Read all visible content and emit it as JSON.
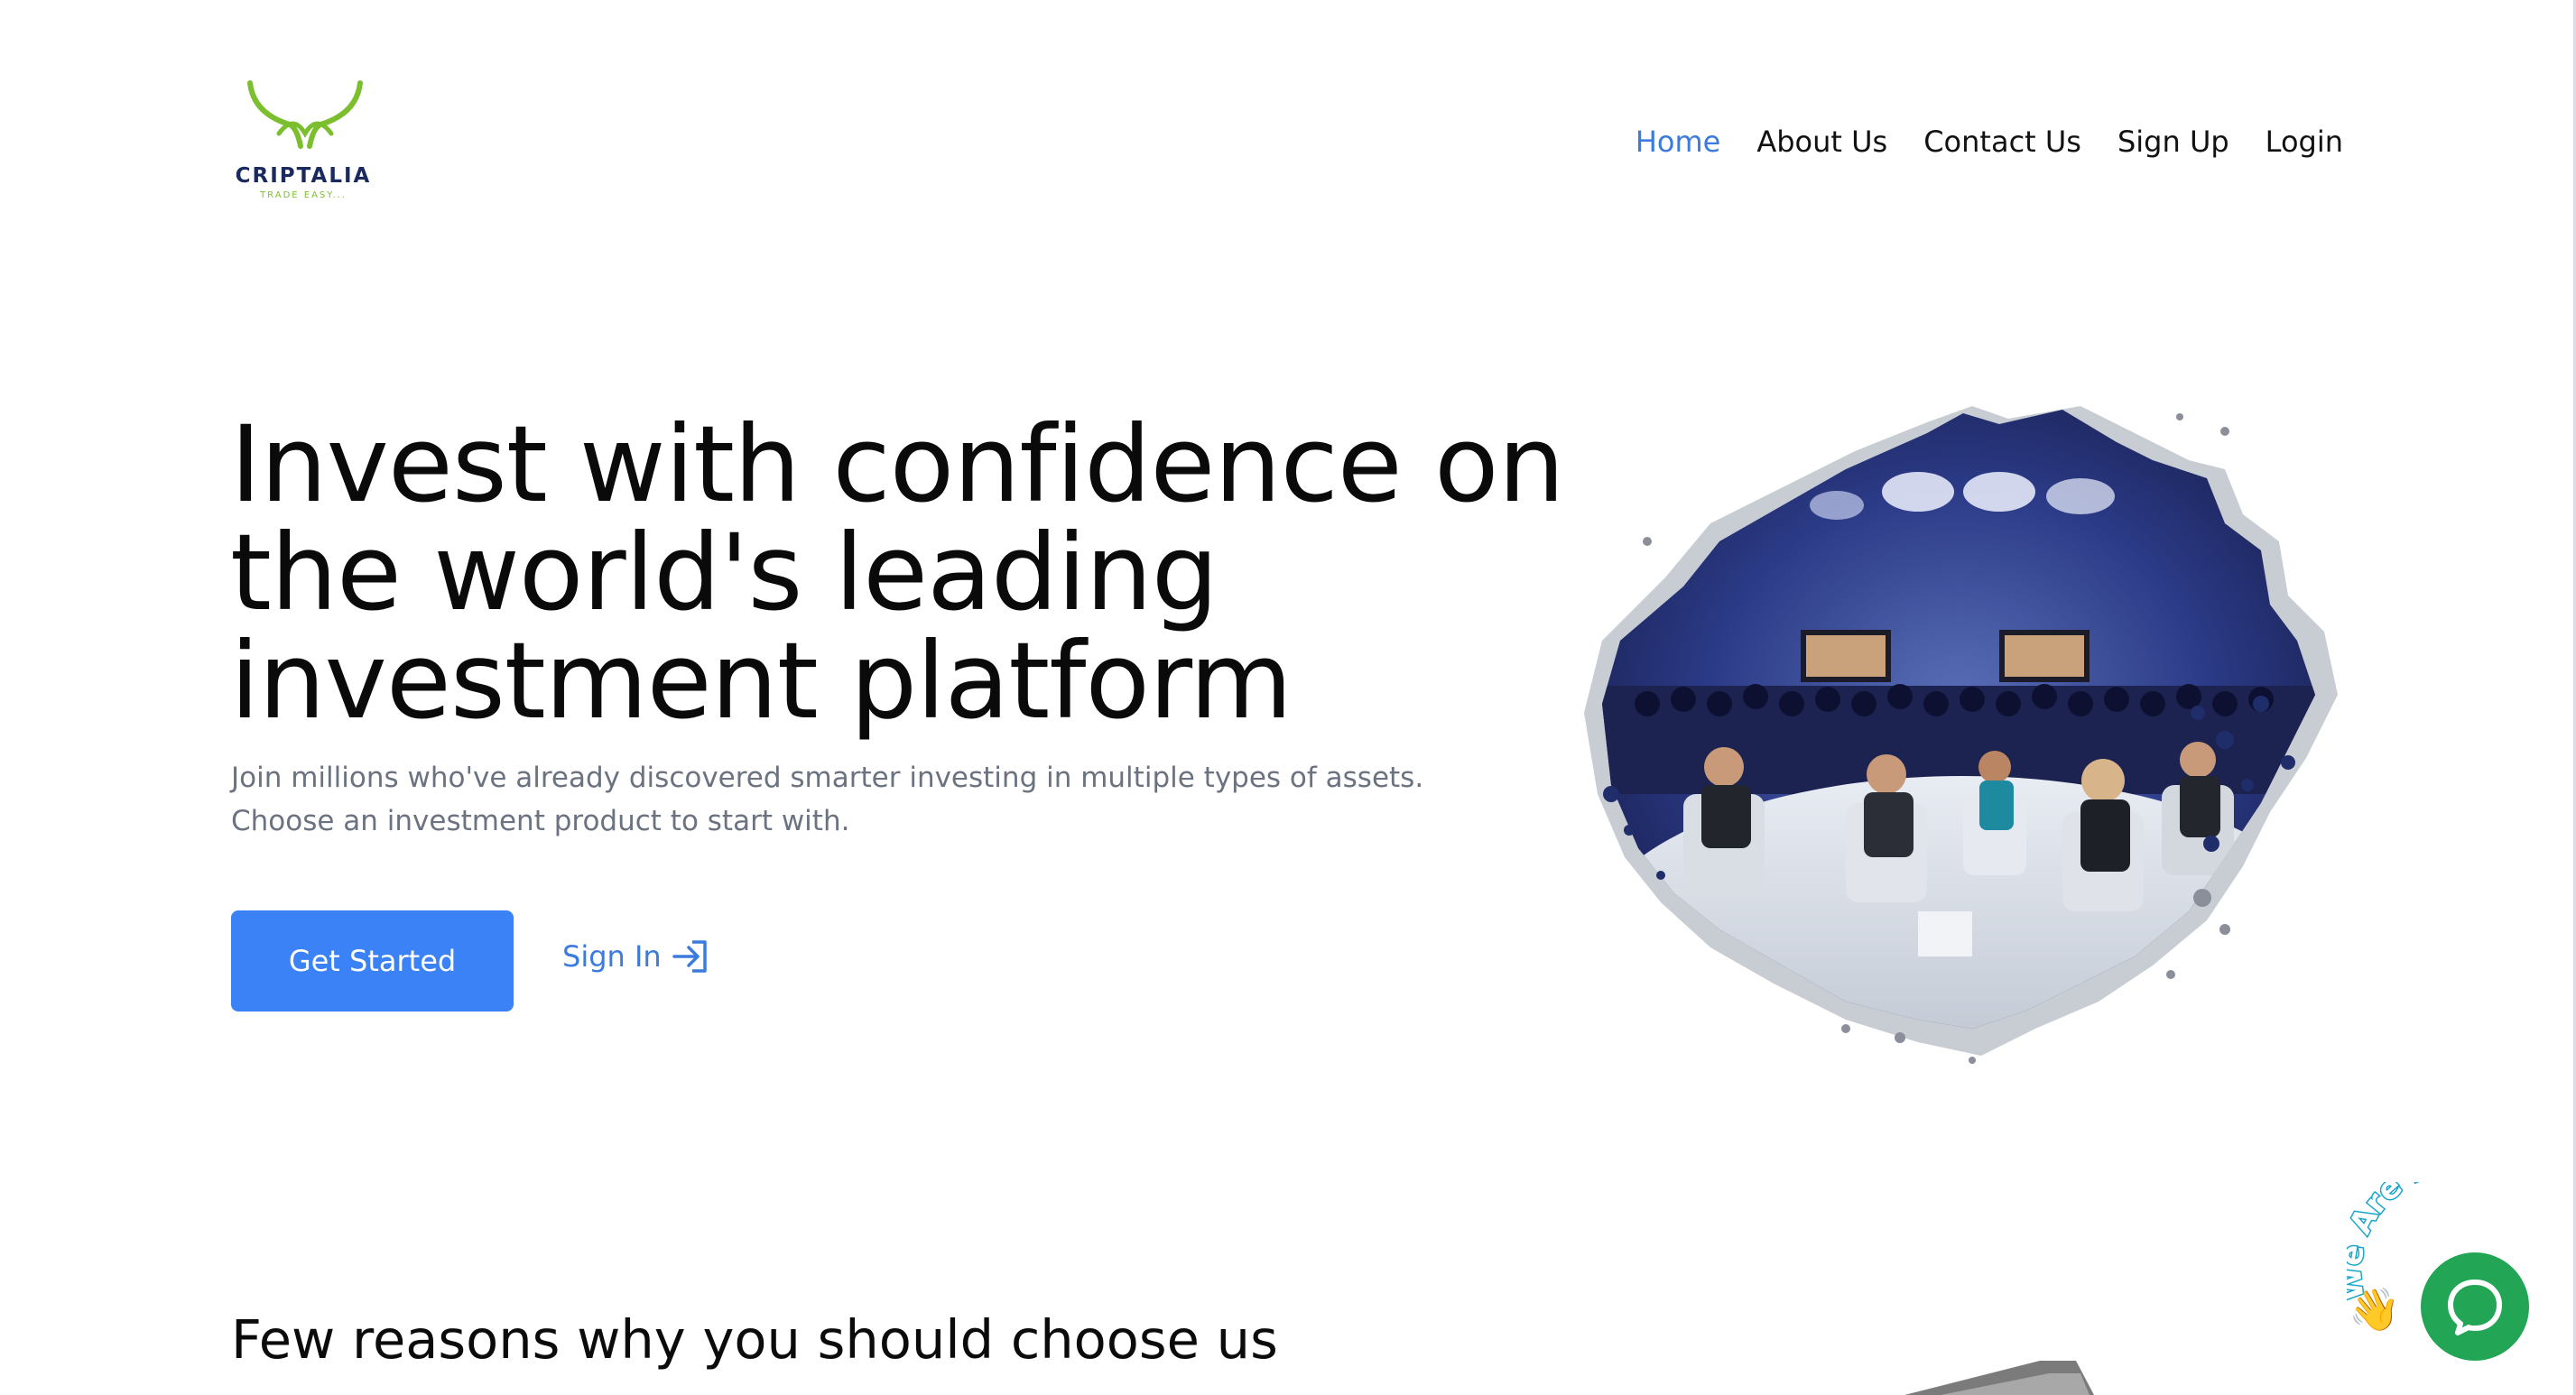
{
  "brand": {
    "name": "CRIPTALIA",
    "tagline": "TRADE EASY...",
    "logo_color": "#7cbf2e",
    "name_color": "#1a2a5e"
  },
  "nav": {
    "items": [
      {
        "label": "Home",
        "active": true
      },
      {
        "label": "About Us",
        "active": false
      },
      {
        "label": "Contact Us",
        "active": false
      },
      {
        "label": "Sign Up",
        "active": false
      },
      {
        "label": "Login",
        "active": false
      }
    ],
    "active_color": "#3b7be0"
  },
  "hero": {
    "title_lines": [
      "Invest with confidence on",
      "the world's leading",
      "investment platform"
    ],
    "subtitle": "Join millions who've already discovered smarter investing in multiple types of assets. Choose an investment product to start with.",
    "primary_button": "Get Started",
    "secondary_link": "Sign In",
    "secondary_icon": "sign-in-arrow-icon",
    "image_icon": "conference-panel-image",
    "button_color": "#3b82f6"
  },
  "reasons": {
    "title": "Few reasons why you should choose us"
  },
  "chat_widget": {
    "badge_text": "We Are Here!",
    "icon": "chat-bubble-icon",
    "wave_icon": "waving-hand-icon",
    "color": "#22a555"
  }
}
